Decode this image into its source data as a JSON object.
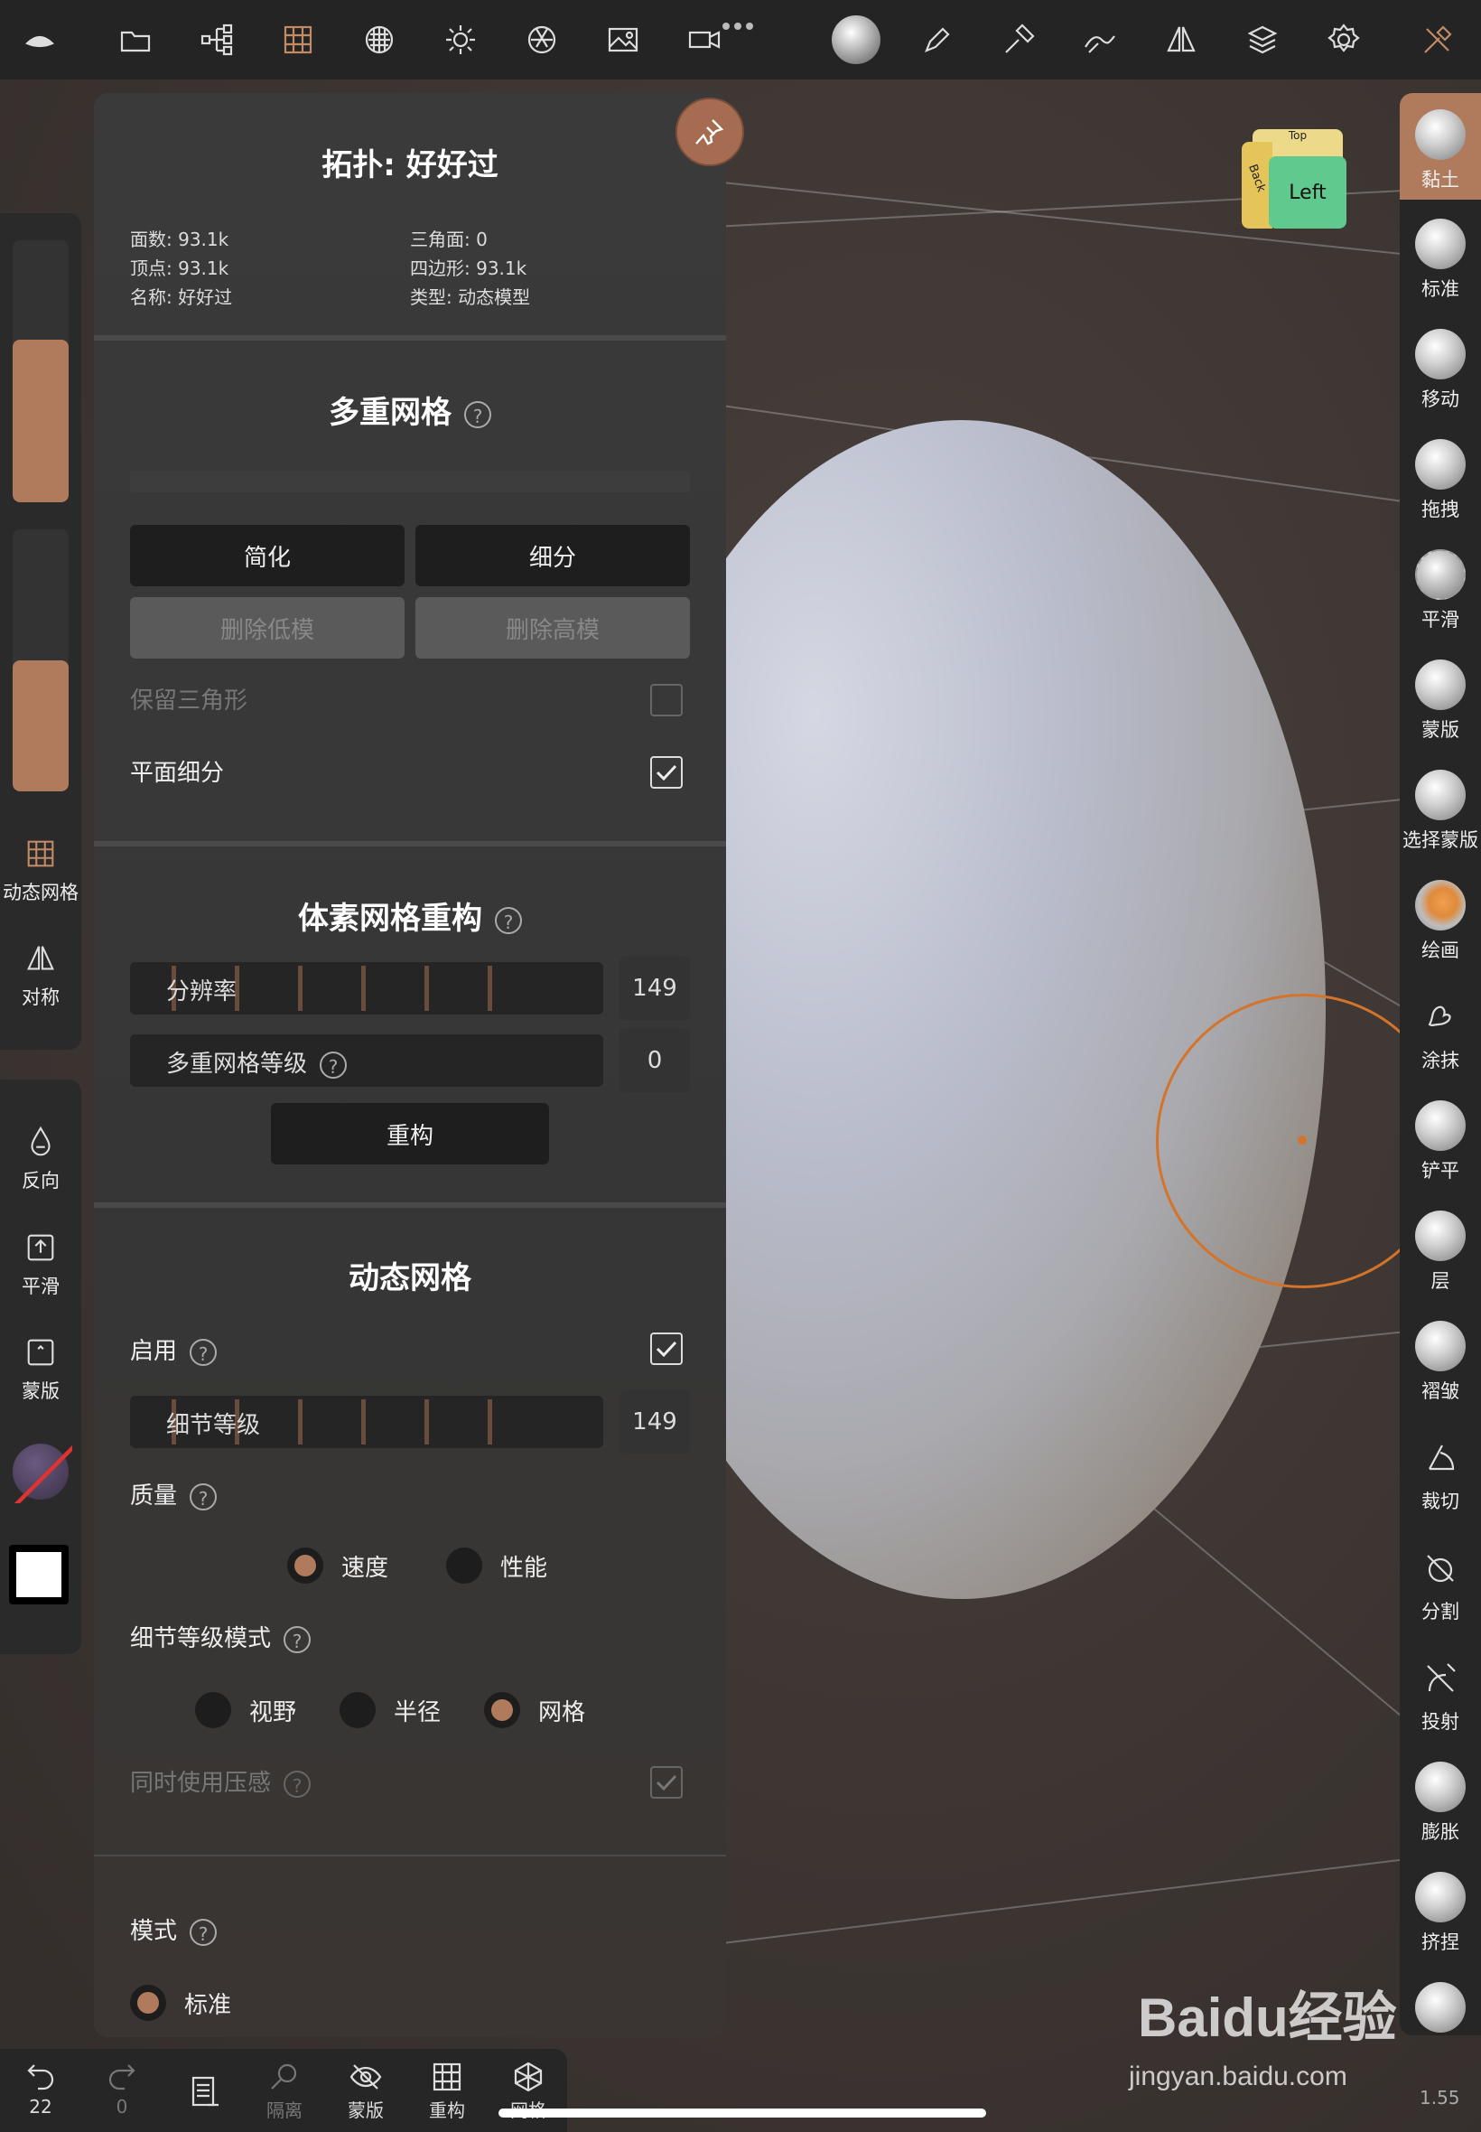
{
  "toolbar": {
    "icons": [
      "nomad-logo-icon",
      "folder-icon",
      "scene-tree-icon",
      "topology-grid-icon",
      "material-sphere-icon",
      "light-sun-icon",
      "camera-shutter-icon",
      "image-icon",
      "video-icon",
      "matcap-ball-icon",
      "paint-brush-icon",
      "hammer-icon",
      "stroke-icon",
      "symmetry-icon",
      "layers-icon",
      "settings-gear-icon",
      "tools-icon"
    ]
  },
  "left_bar": {
    "items": [
      {
        "label": "动态网格",
        "icon": "grid-icon"
      },
      {
        "label": "对称",
        "icon": "symmetry-icon"
      },
      {
        "label": "反向",
        "icon": "drop-icon"
      },
      {
        "label": "平滑",
        "icon": "smooth-icon"
      },
      {
        "label": "蒙版",
        "icon": "mask-icon"
      }
    ],
    "radius_level": 0.62,
    "intensity_level": 0.5
  },
  "nav_cube": {
    "front": "Left",
    "side": "Back",
    "top": "Top"
  },
  "panel": {
    "title": "拓扑: 好好过",
    "stats": {
      "faces": "面数: 93.1k",
      "vertices": "顶点: 93.1k",
      "name": "名称: 好好过",
      "triangles": "三角面: 0",
      "quads": "四边形: 93.1k",
      "type": "类型: 动态模型"
    },
    "multires": {
      "title": "多重网格",
      "reverse": "简化",
      "subdivide": "细分",
      "delete_lower": "删除低模",
      "delete_higher": "删除高模",
      "keep_triangles": "保留三角形",
      "linear_subdiv": "平面细分"
    },
    "voxel": {
      "title": "体素网格重构",
      "resolution_label": "分辨率",
      "resolution_value": "149",
      "multires_label": "多重网格等级",
      "multires_value": "0",
      "remesh": "重构"
    },
    "dynamic": {
      "title": "动态网格",
      "enable": "启用",
      "detail_label": "细节等级",
      "detail_value": "149",
      "quality": "质量",
      "speed": "速度",
      "performance": "性能",
      "detail_mode": "细节等级模式",
      "view": "视野",
      "radius": "半径",
      "mesh": "网格",
      "pressure": "同时使用压感"
    },
    "mode": {
      "title": "模式",
      "standard": "标准"
    }
  },
  "right_bar": {
    "tools": [
      "黏土",
      "标准",
      "移动",
      "拖拽",
      "平滑",
      "蒙版",
      "选择蒙版",
      "绘画",
      "涂抹",
      "铲平",
      "层",
      "褶皱",
      "裁切",
      "分割",
      "投射",
      "膨胀",
      "挤捏"
    ]
  },
  "bottom_bar": {
    "undo_count": "22",
    "redo_count": "0",
    "isolate": "隔离",
    "mask": "蒙版",
    "remesh": "重构",
    "wireframe": "网格"
  },
  "watermark": {
    "brand": "Baidu经验",
    "url": "jingyan.baidu.com"
  },
  "zoom_value": "1.55",
  "colors": {
    "accent": "#b07b5c",
    "brush_ring": "#d4742b"
  }
}
